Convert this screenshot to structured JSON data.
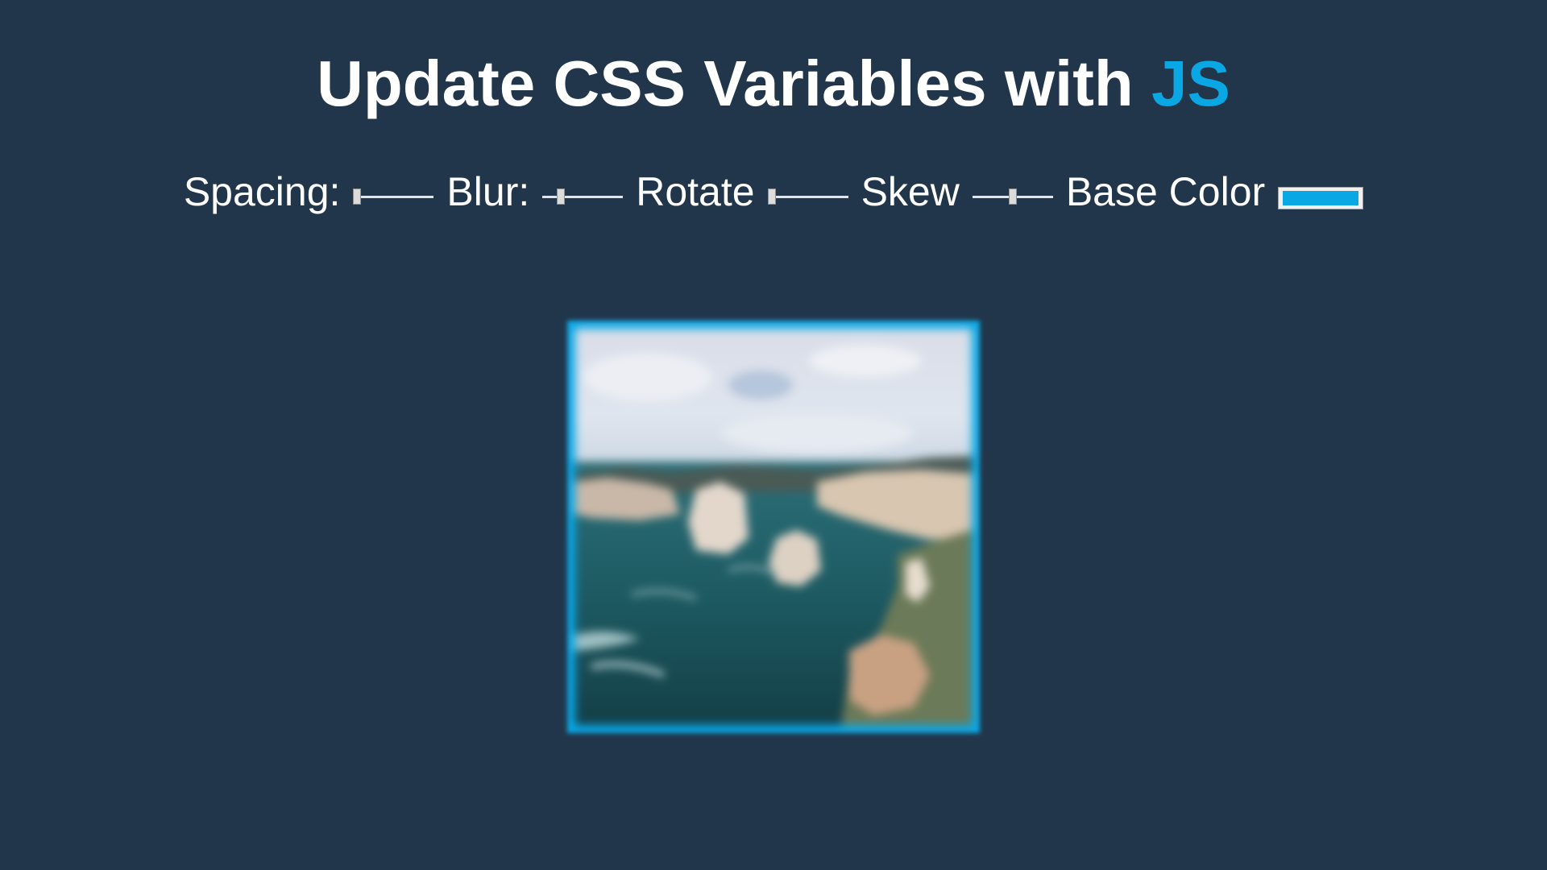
{
  "title": {
    "text": "Update CSS Variables with ",
    "highlight": "JS"
  },
  "controls": {
    "spacing": {
      "label": "Spacing:",
      "value": 10,
      "min": 10,
      "max": 200
    },
    "blur": {
      "label": "Blur:",
      "value": 10,
      "min": 0,
      "max": 50
    },
    "rotate": {
      "label": "Rotate",
      "value": 0,
      "min": 0,
      "max": 360
    },
    "skew": {
      "label": "Skew",
      "value": 0,
      "min": -50,
      "max": 50
    },
    "base_color": {
      "label": "Base Color",
      "value": "#0aa7e5"
    }
  },
  "image": {
    "subject": "coastal cliffs and ocean under cloudy sky"
  },
  "colors": {
    "background": "#22364b",
    "accent": "#0aa7e5",
    "text": "#ffffff"
  }
}
